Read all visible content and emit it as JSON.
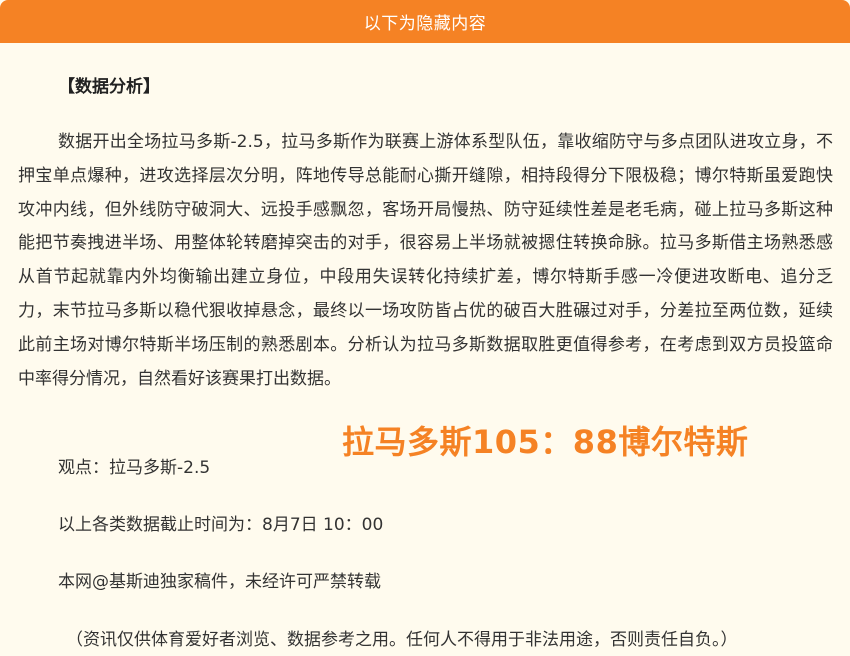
{
  "header": {
    "title": "以下为隐藏内容"
  },
  "article": {
    "heading": "【数据分析】",
    "analysis": "数据开出全场拉马多斯-2.5，拉马多斯作为联赛上游体系型队伍，靠收缩防守与多点团队进攻立身，不押宝单点爆种，进攻选择层次分明，阵地传导总能耐心撕开缝隙，相持段得分下限极稳；博尔特斯虽爱跑快攻冲内线，但外线防守破洞大、远投手感飘忽，客场开局慢热、防守延续性差是老毛病，碰上拉马多斯这种能把节奏拽进半场、用整体轮转磨掉突击的对手，很容易上半场就被摁住转换命脉。拉马多斯借主场熟悉感从首节起就靠内外均衡输出建立身位，中段用失误转化持续扩差，博尔特斯手感一冷便进攻断电、追分乏力，末节拉马多斯以稳代狠收掉悬念，最终以一场攻防皆占优的破百大胜碾过对手，分差拉至两位数，延续此前主场对博尔特斯半场压制的熟悉剧本。分析认为拉马多斯数据取胜更值得参考，在考虑到双方员投篮命中率得分情况，自然看好该赛果打出数据。",
    "score": "拉马多斯105：88博尔特斯",
    "viewpoint": "观点：拉马多斯-2.5",
    "deadline": "以上各类数据截止时间为：8月7日 10：00",
    "copyright": "本网@基斯迪独家稿件，未经许可严禁转载",
    "disclaimer": "（资讯仅供体育爱好者浏览、数据参考之用。任何人不得用于非法用途，否则责任自负。）"
  },
  "colors": {
    "accent": "#f58224",
    "background": "#fffbee",
    "text": "#333333"
  }
}
